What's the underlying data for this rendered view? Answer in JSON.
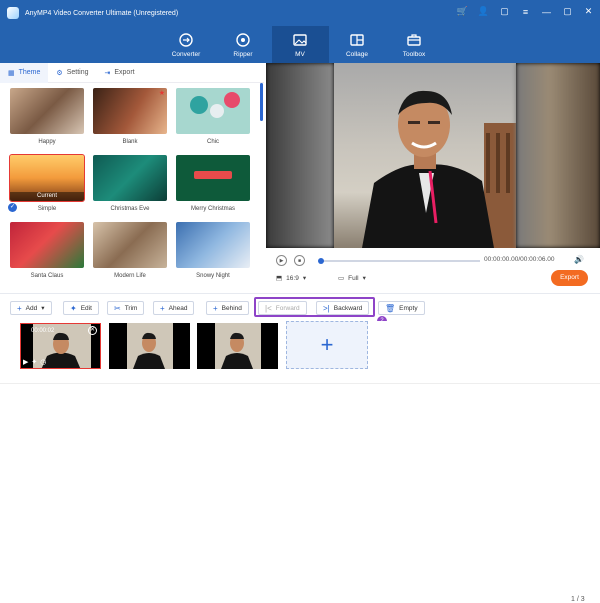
{
  "app": {
    "title": "AnyMP4 Video Converter Ultimate (Unregistered)"
  },
  "nav": {
    "items": [
      {
        "label": "Converter",
        "icon": "converter-icon"
      },
      {
        "label": "Ripper",
        "icon": "ripper-icon"
      },
      {
        "label": "MV",
        "icon": "mv-icon"
      },
      {
        "label": "Collage",
        "icon": "collage-icon"
      },
      {
        "label": "Toolbox",
        "icon": "toolbox-icon"
      }
    ],
    "active": "MV"
  },
  "tabs": {
    "theme": "Theme",
    "setting": "Setting",
    "export": "Export"
  },
  "themes": [
    {
      "label": "Happy"
    },
    {
      "label": "Blank"
    },
    {
      "label": "Chic"
    },
    {
      "label": "Simple",
      "current_tag": "Current"
    },
    {
      "label": "Christmas Eve"
    },
    {
      "label": "Merry Christmas"
    },
    {
      "label": "Santa Claus"
    },
    {
      "label": "Modern Life"
    },
    {
      "label": "Snowy Night"
    }
  ],
  "player": {
    "timecode": "00:00:00.00/00:00:06.00",
    "ratio": "16:9",
    "mode": "Full",
    "export_label": "Export"
  },
  "edit_toolbar": {
    "add": "Add",
    "edit": "Edit",
    "trim": "Trim",
    "ahead": "Ahead",
    "behind": "Behind",
    "forward": "Forward",
    "backward": "Backward",
    "empty": "Empty",
    "page": "1 / 3",
    "badge": "2"
  },
  "clips": {
    "first_time": "00:00:02"
  },
  "colors": {
    "brand_blue": "#2563b0",
    "accent_blue": "#2b67d1",
    "export_orange": "#f36b21",
    "highlight_purple": "#8e44c8"
  }
}
